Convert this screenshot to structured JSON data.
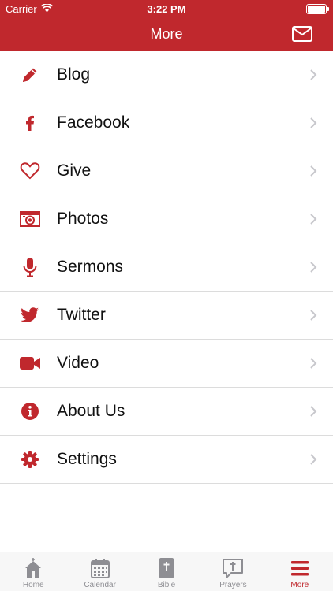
{
  "status_bar": {
    "carrier": "Carrier",
    "time": "3:22 PM",
    "battery_level": 1.0
  },
  "header": {
    "title": "More",
    "mail_icon": "envelope-icon"
  },
  "colors": {
    "brand": "#c0282d",
    "tab_inactive": "#8e8e93",
    "background": "#ffffff"
  },
  "menu": {
    "items": [
      {
        "label": "Blog",
        "icon": "pencil-icon"
      },
      {
        "label": "Facebook",
        "icon": "facebook-icon"
      },
      {
        "label": "Give",
        "icon": "heart-icon"
      },
      {
        "label": "Photos",
        "icon": "camera-icon"
      },
      {
        "label": "Sermons",
        "icon": "microphone-icon"
      },
      {
        "label": "Twitter",
        "icon": "twitter-icon"
      },
      {
        "label": "Video",
        "icon": "video-camera-icon"
      },
      {
        "label": "About Us",
        "icon": "info-icon"
      },
      {
        "label": "Settings",
        "icon": "gear-icon"
      }
    ]
  },
  "tabbar": {
    "tabs": [
      {
        "label": "Home",
        "icon": "church-icon"
      },
      {
        "label": "Calendar",
        "icon": "calendar-icon"
      },
      {
        "label": "Bible",
        "icon": "bible-icon"
      },
      {
        "label": "Prayers",
        "icon": "prayer-icon"
      },
      {
        "label": "More",
        "icon": "hamburger-menu-icon"
      }
    ],
    "active": "More"
  }
}
